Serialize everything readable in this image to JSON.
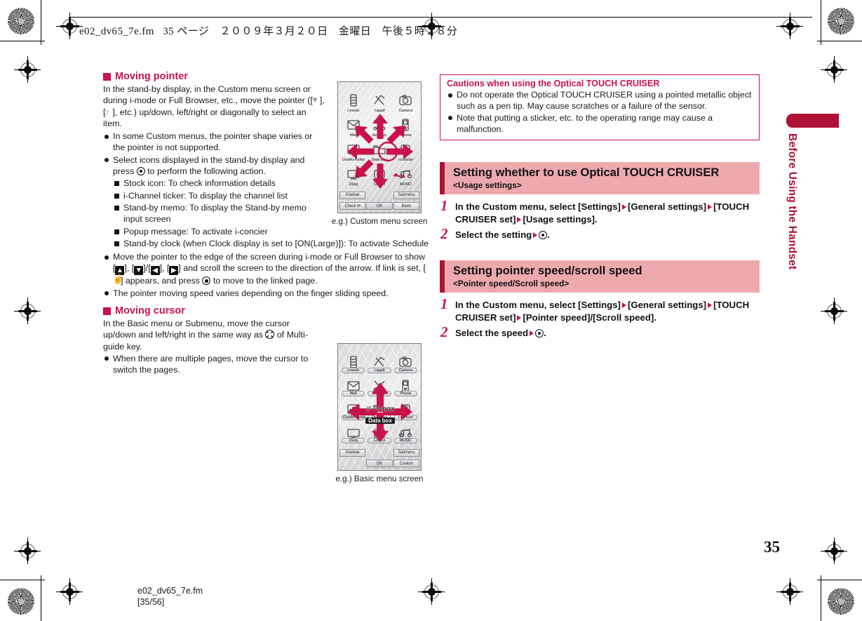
{
  "header": {
    "slug": "e02_dv65_7e.fm   35 ページ　２００９年３月２０日　金曜日　午後５時２８分"
  },
  "side_tab": {
    "label": "Before Using the Handset"
  },
  "page_number": "35",
  "footer": {
    "file": "e02_dv65_7e.fm",
    "pages": "[35/56]"
  },
  "colors": {
    "accent_red": "#c8134b",
    "header_pink": "#eda9ae",
    "header_bar": "#b01236",
    "tab_red": "#b01236"
  },
  "left_column": {
    "section1": {
      "heading": "Moving pointer",
      "intro": "In the stand-by display, in the Custom menu screen or during i-mode or Full Browser, etc., move the pointer ([↖], [▷], etc.) up/down, left/right or diagonally to select an item.",
      "intro_p1": "In the stand-by display, in the Custom menu screen or during i-mode or Full Browser, etc., move the pointer ([",
      "intro_p2": "], [",
      "intro_p3": "], etc.) up/down, left/right or diagonally to select an item.",
      "bullets": [
        {
          "text": "In some Custom menus, the pointer shape varies or the pointer is not supported."
        },
        {
          "text_a": "Select icons displayed in the stand-by display and press ",
          "text_b": " to perform the following action.",
          "sub": [
            "Stock icon: To check information details",
            "i-Channel ticker: To display the channel list",
            "Stand-by memo: To display the Stand-by memo input screen",
            "Popup message: To activate i-concier",
            "Stand-by clock (when Clock display is set to [ON(Large)]): To activate Schedule"
          ]
        }
      ],
      "bullet_move_a": "Move the pointer to the edge of the screen during i-mode or Full Browser to show [",
      "bullet_move_b": "], [",
      "bullet_move_c": "]/[",
      "bullet_move_d": "], [",
      "bullet_move_e": "] and scroll the screen to the direction of the arrow. If link is set, [",
      "bullet_move_f": "] appears, and press ",
      "bullet_move_g": " to move to the linked page.",
      "bullet_speed": "The pointer moving speed varies depending on the finger sliding speed."
    },
    "section2": {
      "heading": "Moving cursor",
      "intro_a": "In the Basic menu or Submenu, move the cursor up/down and left/right in the same way as ",
      "intro_b": " of Multi-guide key.",
      "bullets": [
        "When there are multiple pages, move the cursor to switch the pages."
      ]
    }
  },
  "figures": [
    {
      "id": "custom-menu",
      "caption": "e.g.) Custom menu screen",
      "tiles": [
        {
          "label": "i-mode",
          "icon": "i-mode-icon"
        },
        {
          "label": "i-appli",
          "icon": "i-appli-icon"
        },
        {
          "label": "Camera",
          "icon": "camera-icon"
        },
        {
          "label": "Mail",
          "icon": "mail-icon"
        },
        {
          "label": "Settings",
          "icon": "settings-icon"
        },
        {
          "label": "Phone",
          "icon": "phone-icon"
        },
        {
          "label": "Osaifu-Keitai",
          "icon": "osaifu-keitai-icon"
        },
        {
          "label": "Data box",
          "icon": "data-box-icon"
        },
        {
          "label": "i-concier",
          "icon": "i-concier-icon"
        },
        {
          "label": "1Seg",
          "icon": "one-seg-icon"
        },
        {
          "label": "LifeKit",
          "icon": "lifekit-icon"
        },
        {
          "label": "MUSIC",
          "icon": "music-icon"
        }
      ],
      "softkeys": [
        "Kisekae",
        "",
        "Submenu",
        "Check ✉",
        "OK",
        "Basic"
      ]
    },
    {
      "id": "basic-menu",
      "caption": "e.g.) Basic menu screen",
      "center_label_jp": "データBOX",
      "center_label_en": "Data box",
      "tiles": [
        {
          "label": "i-mode",
          "icon": "i-mode-icon"
        },
        {
          "label": "i-appli",
          "icon": "i-appli-icon"
        },
        {
          "label": "Camera",
          "icon": "camera-icon"
        },
        {
          "label": "Mail",
          "icon": "mail-icon"
        },
        {
          "label": "Settings",
          "icon": "settings-icon"
        },
        {
          "label": "Phone",
          "icon": "phone-icon"
        },
        {
          "label": "Osaifu-Keitai",
          "icon": "osaifu-keitai-icon"
        },
        {
          "label": "Data box",
          "icon": "data-box-icon"
        },
        {
          "label": "i-concier",
          "icon": "i-concier-icon"
        },
        {
          "label": "1Seg",
          "icon": "one-seg-icon"
        },
        {
          "label": "LifeKit",
          "icon": "lifekit-icon"
        },
        {
          "label": "MUSIC",
          "icon": "music-icon"
        }
      ],
      "softkeys": [
        "Kisekae",
        "",
        "Submenu",
        "",
        "OK",
        "Custom"
      ]
    }
  ],
  "right_column": {
    "caution": {
      "title": "Cautions when using the Optical TOUCH CRUISER",
      "bullets": [
        "Do not operate the Optical TOUCH CRUISER using a pointed metallic object such as a pen tip. May cause scratches or a failure of the sensor.",
        "Note that putting a sticker, etc. to the operating range may cause a malfunction."
      ]
    },
    "sections": [
      {
        "title": "Setting whether to use Optical TOUCH CRUISER",
        "subtitle": "<Usage settings>",
        "steps": [
          {
            "num": "1",
            "parts": [
              "In the Custom menu, select [Settings]",
              "[General settings]",
              "[TOUCH CRUISER set]",
              "[Usage settings]."
            ]
          },
          {
            "num": "2",
            "parts": [
              "Select the setting",
              "⊙."
            ]
          }
        ]
      },
      {
        "title": "Setting pointer speed/scroll speed",
        "subtitle": "<Pointer speed/Scroll speed>",
        "steps": [
          {
            "num": "1",
            "parts": [
              "In the Custom menu, select [Settings]",
              "[General settings]",
              "[TOUCH CRUISER set]",
              "[Pointer speed]/[Scroll speed]."
            ]
          },
          {
            "num": "2",
            "parts": [
              "Select the speed",
              "⊙."
            ]
          }
        ]
      }
    ]
  }
}
